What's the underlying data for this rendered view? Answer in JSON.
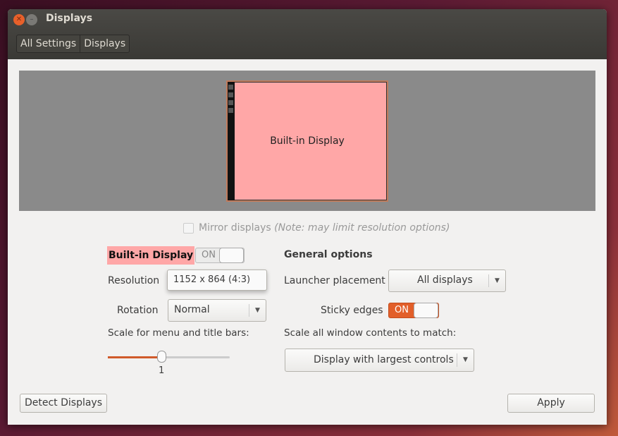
{
  "window": {
    "title": "Displays"
  },
  "breadcrumb": [
    "All Settings",
    "Displays"
  ],
  "preview": {
    "monitor_label": "Built-in Display",
    "monitor_color": "#ffa7a7"
  },
  "mirror": {
    "label": "Mirror displays",
    "note": "(Note: may limit resolution options)",
    "checked": false
  },
  "display": {
    "name": "Built-in Display",
    "toggle": "ON",
    "resolution_label": "Resolution",
    "resolution_value": "1152 x 864 (4:3)",
    "rotation_label": "Rotation",
    "rotation_value": "Normal",
    "scale_label": "Scale for menu and title bars:",
    "scale_value": "1"
  },
  "general": {
    "heading": "General options",
    "launcher_label": "Launcher placement",
    "launcher_value": "All displays",
    "sticky_label": "Sticky edges",
    "sticky_toggle": "ON",
    "scale_all_label": "Scale all window contents to match:",
    "scale_all_value": "Display with largest controls"
  },
  "buttons": {
    "detect": "Detect Displays",
    "apply": "Apply"
  },
  "colors": {
    "accent": "#e25f2a"
  }
}
